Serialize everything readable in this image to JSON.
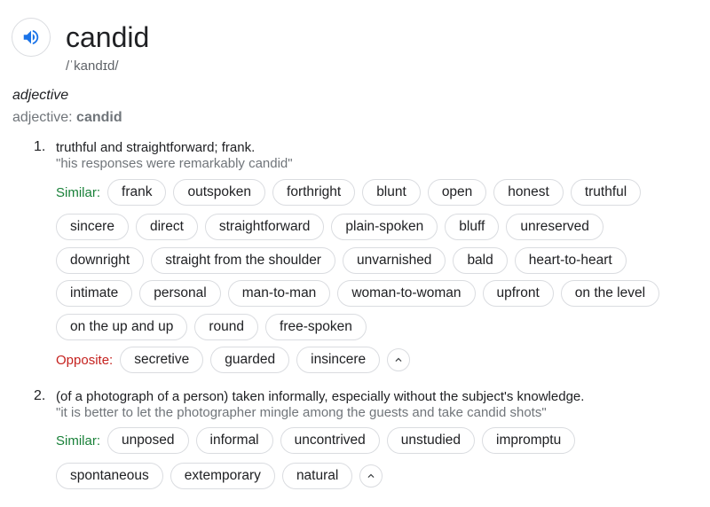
{
  "entry": {
    "word": "candid",
    "phonetic": "/ˈkandɪd/",
    "part_of_speech": "adjective",
    "pos_prefix": "adjective: ",
    "pos_word": "candid",
    "icons": {
      "speaker": "volume-icon",
      "collapse": "chevron-up-icon"
    },
    "colors": {
      "similar": "#188038",
      "opposite": "#c5221f",
      "chip_border": "#dadce0",
      "speaker": "#1a73e8"
    }
  },
  "senses": [
    {
      "number": "1.",
      "definition": "truthful and straightforward; frank.",
      "example": "\"his responses were remarkably candid\"",
      "similar_label": "Similar:",
      "similar_rows": [
        [
          "frank",
          "outspoken",
          "forthright",
          "blunt",
          "open",
          "honest",
          "truthful"
        ],
        [
          "sincere",
          "direct",
          "straightforward",
          "plain-spoken",
          "bluff",
          "unreserved"
        ],
        [
          "downright",
          "straight from the shoulder",
          "unvarnished",
          "bald",
          "heart-to-heart"
        ],
        [
          "intimate",
          "personal",
          "man-to-man",
          "woman-to-woman",
          "upfront",
          "on the level"
        ],
        [
          "on the up and up",
          "round",
          "free-spoken"
        ]
      ],
      "opposite_label": "Opposite:",
      "opposites": [
        "secretive",
        "guarded",
        "insincere"
      ]
    },
    {
      "number": "2.",
      "definition": "(of a photograph of a person) taken informally, especially without the subject's knowledge.",
      "example": "\"it is better to let the photographer mingle among the guests and take candid shots\"",
      "similar_label": "Similar:",
      "similar_rows": [
        [
          "unposed",
          "informal",
          "uncontrived",
          "unstudied",
          "impromptu"
        ],
        [
          "spontaneous",
          "extemporary",
          "natural"
        ]
      ]
    }
  ]
}
